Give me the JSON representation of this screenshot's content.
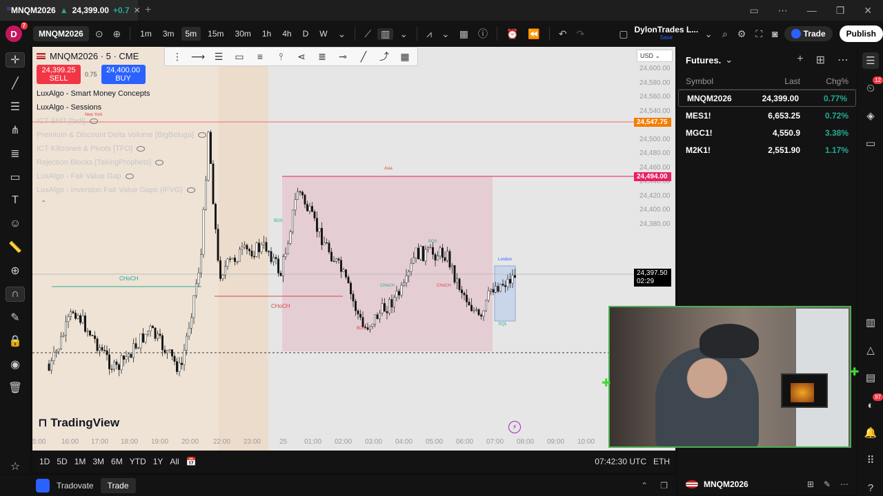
{
  "browser_tab": {
    "symbol": "MNQM2026",
    "price": "24,399.00",
    "change": "+0.7",
    "close": "✕"
  },
  "new_tab": "+",
  "window_controls": [
    "▭",
    "⋯",
    "—",
    "❐",
    "✕"
  ],
  "toolbar": {
    "avatar_initial": "D",
    "avatar_badge": "7",
    "symbol": "MNQM2026",
    "intervals": [
      "1m",
      "3m",
      "5m",
      "15m",
      "30m",
      "1h",
      "4h",
      "D",
      "W"
    ],
    "active_interval": "5m",
    "layout_name": "DylonTrades L...",
    "layout_status": "Save",
    "trade": "Trade",
    "publish": "Publish"
  },
  "chart": {
    "title": "MNQM2026 · 5 · CME",
    "sell_price": "24,399.25",
    "sell_label": "SELL",
    "spread": "0.75",
    "buy_price": "24,400.00",
    "buy_label": "BUY",
    "indicators": [
      {
        "name": "LuxAlgo - Smart Money Concepts",
        "faded": false
      },
      {
        "name": "LuxAlgo - Sessions",
        "faded": false
      },
      {
        "name": "ICT SMT [fadi]",
        "faded": true
      },
      {
        "name": "Premium & Discount Delta Volume [BigBeluga]",
        "faded": true
      },
      {
        "name": "ICT Killzones & Pivots [TFO]",
        "faded": true
      },
      {
        "name": "Rejection Blocks [TakingProphets]",
        "faded": true
      },
      {
        "name": "LuxAlgo - Fair Value Gap",
        "faded": true
      },
      {
        "name": "LuxAlgo - Inversion Fair Value Gaps (IFVG)",
        "faded": true
      }
    ],
    "currency": "USD",
    "price_levels": [
      "24,600.00",
      "24,580.00",
      "24,560.00",
      "24,540.00",
      "24,520.00",
      "24,500.00",
      "24,480.00",
      "24,460.00",
      "24,440.00",
      "24,420.00",
      "24,400.00",
      "24,380.00"
    ],
    "tag_high": "24,547.75",
    "tag_mid": "24,494.00",
    "current_price": "24,397.50",
    "countdown": "02:29",
    "time_labels": [
      "5:00",
      "16:00",
      "17:00",
      "18:00",
      "19:00",
      "20:00",
      "22:00",
      "23:00",
      "25",
      "01:00",
      "02:00",
      "03:00",
      "04:00",
      "05:00",
      "06:00",
      "07:00",
      "08:00",
      "09:00",
      "10:00"
    ],
    "annotations": [
      "CHoCH",
      "CHoCH",
      "CHoCH",
      "CHoCH",
      "BOS",
      "BOS",
      "BOS",
      "London",
      "EQL",
      "New York",
      "Asia"
    ],
    "watermark": "TradingView",
    "colors": {
      "sell": "#f23645",
      "buy": "#2962ff",
      "up": "#22ab94",
      "high_tag": "#f57c00",
      "mid_tag": "#e91e63"
    }
  },
  "rangebar": {
    "ranges": [
      "1D",
      "5D",
      "1M",
      "3M",
      "6M",
      "YTD",
      "1Y",
      "All"
    ],
    "clock": "07:42:30 UTC",
    "session": "ETH"
  },
  "bottombar": {
    "broker": "Tradovate",
    "trade_tab": "Trade"
  },
  "watchlist": {
    "title": "Futures.",
    "columns": [
      "Symbol",
      "Last",
      "Chg%"
    ],
    "rows": [
      {
        "symbol": "MNQM2026",
        "last": "24,399.00",
        "chg": "0.77%"
      },
      {
        "symbol": "MES1!",
        "last": "6,653.25",
        "chg": "0.72%"
      },
      {
        "symbol": "MGC1!",
        "last": "4,550.9",
        "chg": "3.38%"
      },
      {
        "symbol": "M2K1!",
        "last": "2,551.90",
        "chg": "1.17%"
      }
    ],
    "footer_symbol": "MNQM2026"
  },
  "rightbar": {
    "alerts_badge": "12",
    "stream_badge": "97"
  }
}
